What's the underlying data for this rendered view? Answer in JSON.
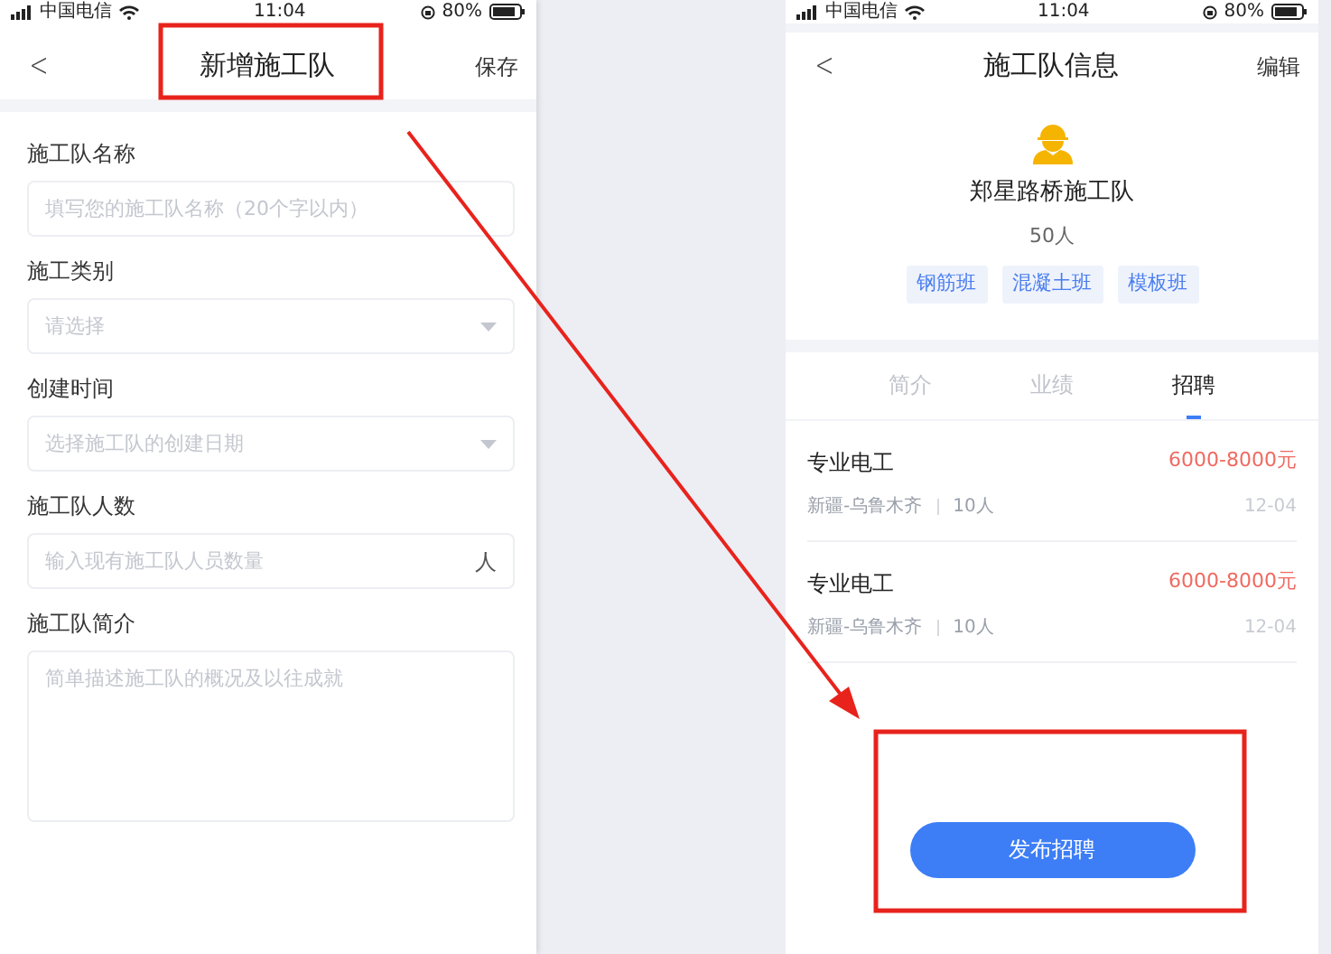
{
  "left_screen": {
    "status_bar": {
      "carrier": "中国电信",
      "time": "11:04",
      "battery": "80%"
    },
    "nav": {
      "back": "<",
      "title": "新增施工队",
      "action": "保存"
    },
    "form_fields": [
      {
        "label": "施工队名称",
        "kind": "text",
        "placeholder": "填写您的施工队名称（20个字以内）"
      },
      {
        "label": "施工类别",
        "kind": "select",
        "placeholder": "请选择"
      },
      {
        "label": "创建时间",
        "kind": "select",
        "placeholder": "选择施工队的创建日期"
      },
      {
        "label": "施工队人数",
        "kind": "suffix",
        "placeholder": "输入现有施工队人员数量",
        "suffix": "人"
      },
      {
        "label": "施工队简介",
        "kind": "textarea",
        "placeholder": "简单描述施工队的概况及以往成就"
      }
    ]
  },
  "right_screen": {
    "status_bar": {
      "carrier": "中国电信",
      "time": "11:04",
      "battery": "80%"
    },
    "nav": {
      "back": "<",
      "title": "施工队信息",
      "action": "编辑"
    },
    "team": {
      "name": "郑星路桥施工队",
      "members": "50人",
      "tags": [
        "钢筋班",
        "混凝土班",
        "模板班"
      ]
    },
    "tabs": [
      {
        "label": "简介",
        "selected": false
      },
      {
        "label": "业绩",
        "selected": false
      },
      {
        "label": "招聘",
        "selected": true
      }
    ],
    "jobs": [
      {
        "title": "专业电工",
        "salary": "6000-8000元",
        "location": "新疆-乌鲁木齐",
        "headcount": "10人",
        "date": "12-04"
      },
      {
        "title": "专业电工",
        "salary": "6000-8000元",
        "location": "新疆-乌鲁木齐",
        "headcount": "10人",
        "date": "12-04"
      }
    ],
    "button": "发布招聘"
  }
}
